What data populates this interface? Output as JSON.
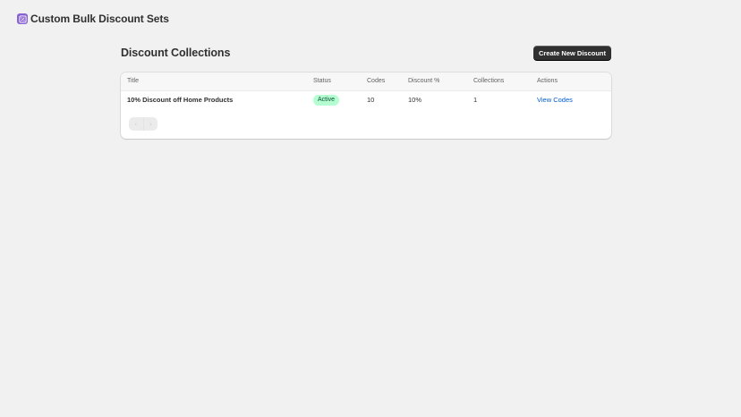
{
  "app": {
    "title": "Custom Bulk Discount Sets",
    "icon": "discount-app-icon",
    "icon_color": "#8a63d2"
  },
  "page": {
    "title": "Discount Collections",
    "primary_action": "Create New Discount"
  },
  "table": {
    "headers": {
      "title": "Title",
      "status": "Status",
      "codes": "Codes",
      "discount": "Discount %",
      "collections": "Collections",
      "actions": "Actions"
    },
    "rows": [
      {
        "title": "10% Discount off Home Products",
        "status": "Active",
        "codes": "10",
        "discount": "10%",
        "collections": "1",
        "action": "View Codes"
      }
    ]
  },
  "pagination": {
    "previous_icon": "chevron-left-icon",
    "next_icon": "chevron-right-icon",
    "previous_enabled": false,
    "next_enabled": false
  },
  "colors": {
    "background": "#f1f1f1",
    "primary_button": "#303030",
    "badge_active_bg": "#b4fed2",
    "badge_active_text": "#0c5132",
    "link": "#005bd3"
  }
}
